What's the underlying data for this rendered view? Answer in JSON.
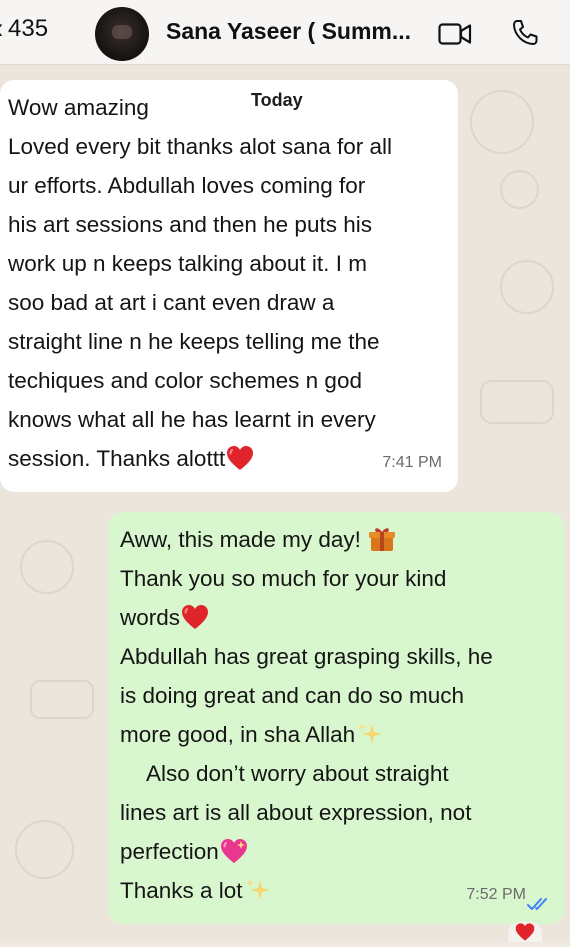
{
  "header": {
    "back_count": "435",
    "contact_name": "Sana Yaseer ( Summ...",
    "icons": {
      "back": "chevron-left-icon",
      "avatar": "avatar",
      "video": "video-camera-icon",
      "call": "phone-icon"
    }
  },
  "date_label": "Today",
  "messages": [
    {
      "direction": "incoming",
      "lines": [
        "Wow amazing",
        "Loved every bit thanks alot sana for all",
        "ur efforts. Abdullah loves coming for",
        "his art sessions and then he puts his",
        "work up n keeps talking about it. I m",
        "soo bad at art i cant even draw a",
        "straight line n he keeps telling me the",
        "techiques and color schemes n god",
        "knows what all he has learnt in every",
        "session. Thanks alottt"
      ],
      "time": "7:41 PM"
    },
    {
      "direction": "outgoing",
      "lines": [
        "Aww, this made my day!",
        "Thank you so much for your kind",
        "words",
        "Abdullah has great grasping skills, he",
        "is doing great and can do so much",
        "more good, in sha Allah",
        "Also don’t worry about straight",
        "lines art is all about expression, not",
        "perfection",
        "Thanks a lot"
      ],
      "time": "7:52 PM",
      "status": "read"
    }
  ],
  "colors": {
    "incoming_bubble": "#ffffff",
    "outgoing_bubble": "#d9f7cf",
    "read_ticks": "#3b82f6",
    "heart": "#e0242c"
  },
  "reaction": "heart"
}
